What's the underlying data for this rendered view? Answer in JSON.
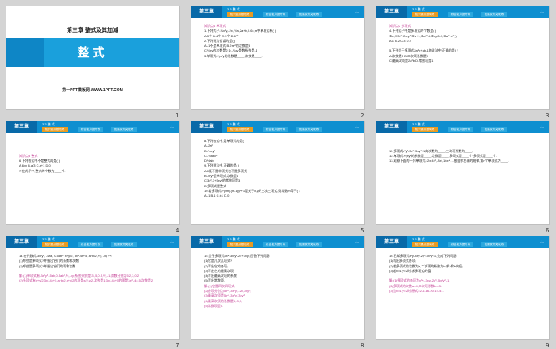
{
  "common": {
    "chapter": "第三章",
    "section": "3.3  整  式",
    "tab1": "知识要点基础练",
    "tab2": "综合能力提升练",
    "tab3": "拓展探究突破练",
    "page": "-1-"
  },
  "slides": [
    {
      "number": "1",
      "type": "title",
      "chapter_title": "第三章 整式及其加减",
      "title": "整式",
      "subtitle": "第一PPT模板网-WWW.1PPT.COM"
    },
    {
      "number": "2",
      "lines": [
        {
          "t": "知识点1  单项式",
          "c": "hl"
        },
        {
          "t": "1.下列式子-⅓x²y,-2x,-¾a,2a+b,0.6x,π中单项式有(    )"
        },
        {
          "t": "A.3个          B.4个          C.5个          D.6个"
        },
        {
          "t": "2.下列说法错误的是(    )"
        },
        {
          "t": "A.-1不是单项式     B.2πr²的次数是3"
        },
        {
          "t": "C.⅔xy的次数是2    D.-⅓xy是数系数是-1"
        },
        {
          "t": "3.单项式-³⁄₅x²y的系数是____,次数是____."
        }
      ]
    },
    {
      "number": "3",
      "lines": [
        {
          "t": "知识点2  多项式",
          "c": "hl"
        },
        {
          "t": "4.下列式子中是多项式的个数是(    )"
        },
        {
          "t": "①x;②3x²+2x-y²;③a+1;④a²-½;⑤xy/3-1;⑥a²+x²(    )"
        },
        {
          "t": "A.1          B.2          C.3          D.4"
        },
        {
          "t": ""
        },
        {
          "t": "5.下列关于多项式2a²b+ab-1的说法中,正确的是(    )"
        },
        {
          "t": "A.次数是5        B.二次项系数是0"
        },
        {
          "t": "C.最高次项是2a²b    D.常数项是1"
        }
      ]
    },
    {
      "number": "4",
      "lines": [
        {
          "t": ""
        },
        {
          "t": ""
        },
        {
          "t": ""
        },
        {
          "t": "知识点3  整式",
          "c": "hl"
        },
        {
          "t": "6.下列各式中不是整式的是(    )"
        },
        {
          "t": "A.6xy          B.a/3          C.a+1          D.0"
        },
        {
          "t": "7.在式子中,整式的个数为____个."
        }
      ]
    },
    {
      "number": "5",
      "lines": [
        {
          "t": "8.下列各式中,是单项式的是(    )"
        },
        {
          "t": "A.-2a²"
        },
        {
          "t": "B.-⅓xy²"
        },
        {
          "t": "C.-½abc²"
        },
        {
          "t": "D.½ab"
        },
        {
          "t": "9.下列说法中,正确的是(    )"
        },
        {
          "t": "A.0既不是单项式也不是多项式"
        },
        {
          "t": "B.-x²y²是单项式,次数是4"
        },
        {
          "t": "C.3x²-3+5xy²的常数项是3"
        },
        {
          "t": "D.多项式是整式"
        },
        {
          "t": "10.若多项式x²y|m|-(m-1)y²+1是关于x,y的三次三项式,则常数m等于(    )"
        },
        {
          "t": "A.-1     B.1     C.±1     D.0"
        }
      ]
    },
    {
      "number": "6",
      "lines": [
        {
          "t": ""
        },
        {
          "t": ""
        },
        {
          "t": "11.多项式x²y³-3x²+5xy²+1的次数为____,三次项系数为____."
        },
        {
          "t": "12.单项式-²⁄₃xy²的系数是____,次数是____,多项式是____个,多项式是____个."
        },
        {
          "t": "13.观察下面的一列单项式:-2x,4x²,-8x³,16x⁴,…根据你发现的规律,第n个单项式为____."
        }
      ]
    },
    {
      "number": "7",
      "lines": [
        {
          "t": "14.在代数式-3x²y³, -5ab, 0.5ab², x+y/2, 3x²-4x+5, a+b/2, ²⁄₃, -xy 中:"
        },
        {
          "t": "(1)哪些是单项式?并指出它们的系数和次数;"
        },
        {
          "t": "(2)哪些是多项式?并指出它们的项和次数."
        },
        {
          "t": ""
        },
        {
          "t": "解:(1)单项式有-3x²y³,-5ab,0.5ab²,²⁄₃,-xy;系数分别是-3,-5,0.5,²⁄₃,-1;次数分别为5,2,3,0,2",
          "c": "ans"
        },
        {
          "t": "(2)多项式有x+y/2,3x²-4x+5,a+b/2,x+y/2的项是x/2,y/2,次数是1;3x²-4x+5的项是3x²,-4x,5,次数是2.",
          "c": "ans"
        }
      ]
    },
    {
      "number": "8",
      "lines": [
        {
          "t": "15.关于多项式5x⁴-3x²y²-2x+3xy³,回答下列问题:"
        },
        {
          "t": "(1)它是几次几项式?"
        },
        {
          "t": "(2)写出它的各项;"
        },
        {
          "t": "(3)写出它的最高次项;"
        },
        {
          "t": "(4)写出最高次项的系数;"
        },
        {
          "t": "(5)写出常数项."
        },
        {
          "t": "解:(1)它是四次四项式;",
          "c": "ans"
        },
        {
          "t": "(2)各项分别为5x⁴,-3x²y²,-2x,3xy³;",
          "c": "ans"
        },
        {
          "t": "(3)最高次项是5x⁴,-3x²y²,3xy³;",
          "c": "ans"
        },
        {
          "t": "(4)最高次项的系数是5,-3,3;",
          "c": "ans"
        },
        {
          "t": "(5)常数项是0.",
          "c": "ans"
        }
      ]
    },
    {
      "number": "9",
      "lines": [
        {
          "t": "16.已知多项式x³y-3xy-2y³-5x²y²-1,完成下列问题:"
        },
        {
          "t": "(1)写出多项式各项;"
        },
        {
          "t": "(2)若多项式的次数为a,二次项的系数为b,求a和b的值;"
        },
        {
          "t": "(3)若x=1,y=2时,求多项式的值."
        },
        {
          "t": ""
        },
        {
          "t": "解:(1)多项式的各项为x³y,-3xy,-2y³,-5x²y²,-1",
          "c": "ans"
        },
        {
          "t": "(2)多项式的次数a=4,二次项系数b=-3.",
          "c": "ans"
        },
        {
          "t": "(3)当x=1,y=2时,原式=2-6-16-20-1=-41.",
          "c": "ans"
        }
      ]
    }
  ]
}
